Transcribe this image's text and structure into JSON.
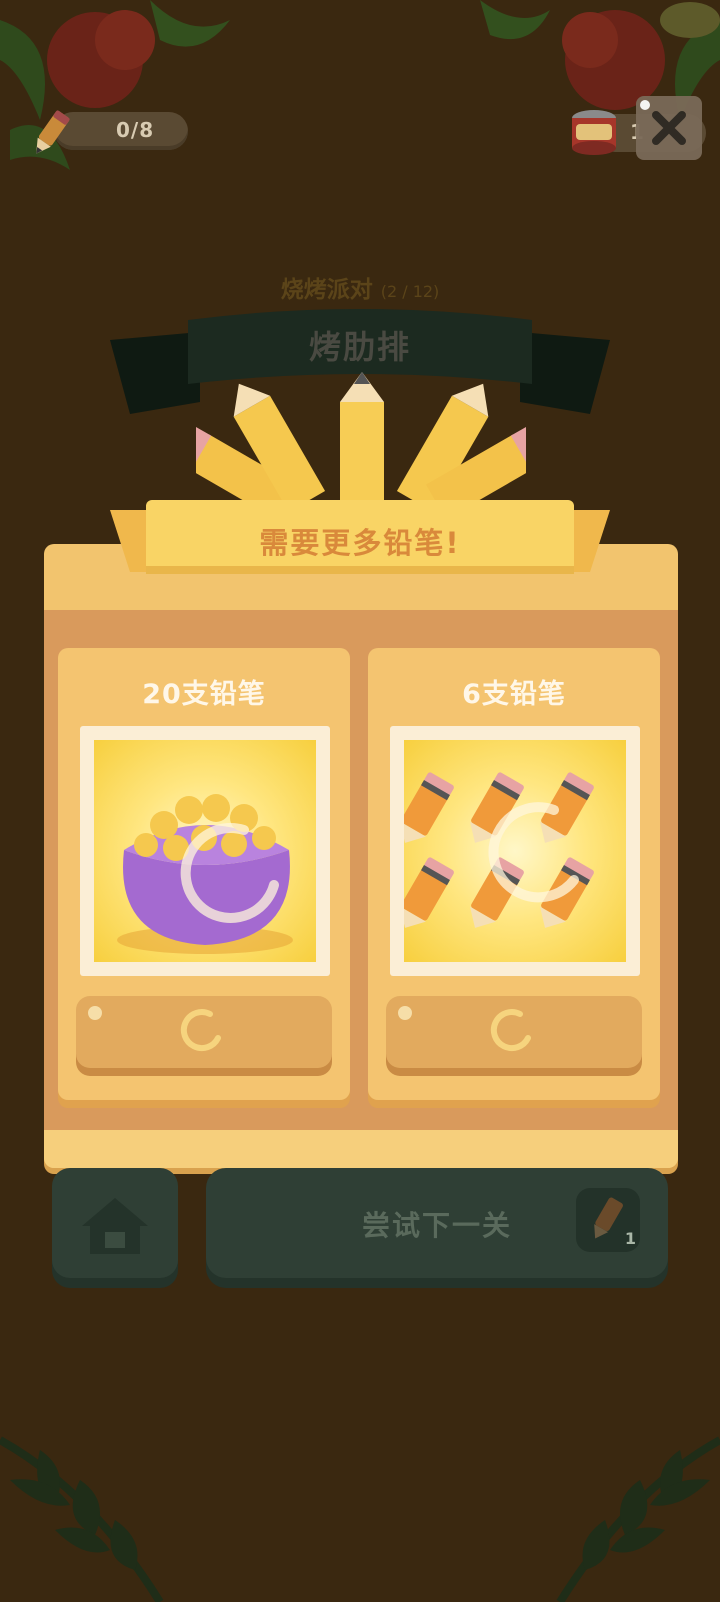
{
  "hud": {
    "pencil_count": "0/8",
    "close_icon": "close-icon",
    "can_count_partial": "1"
  },
  "level": {
    "title": "烧烤派对",
    "progress": "(2 / 12)",
    "dish": "烤肋排"
  },
  "modal": {
    "banner": "需要更多铅笔!",
    "offers": [
      {
        "title": "20支铅笔",
        "image": "pencil-bag-icon"
      },
      {
        "title": "6支铅笔",
        "image": "six-pencils-icon"
      }
    ]
  },
  "bottom": {
    "home_icon": "home-icon",
    "next_label": "尝试下一关",
    "next_pencil_cost": "1"
  },
  "colors": {
    "background": "#3a2810",
    "modal": "#f2c46e",
    "accent_orange": "#d9893b"
  }
}
